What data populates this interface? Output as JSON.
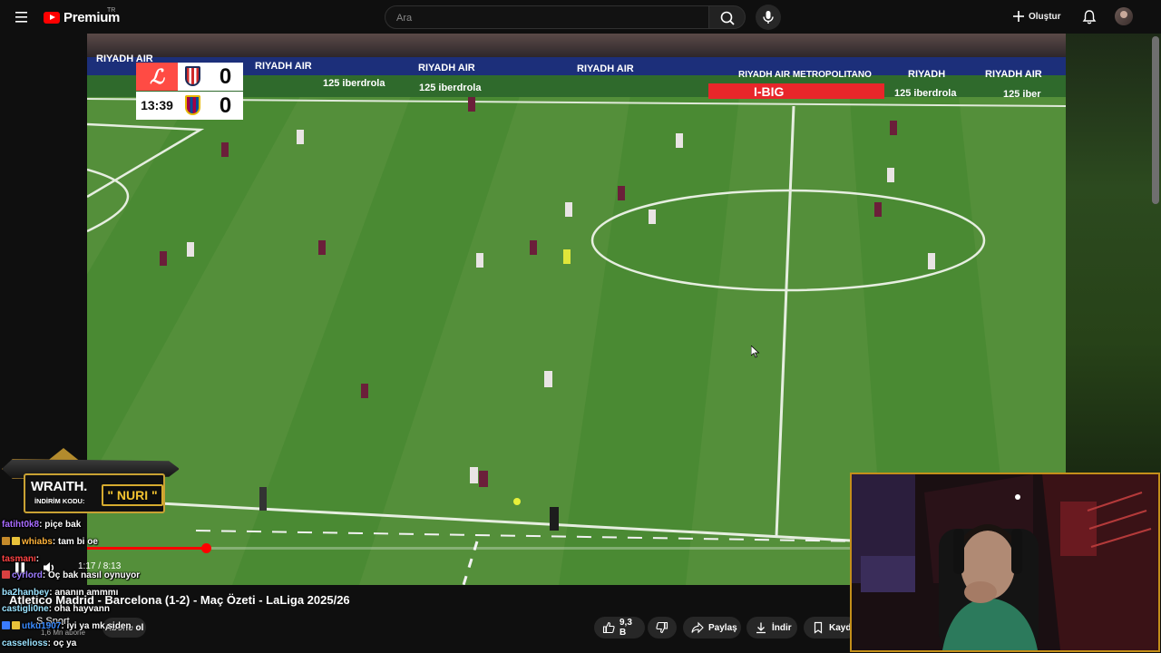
{
  "topbar": {
    "logo_text": "Premium",
    "country_code": "TR",
    "search_placeholder": "Ara",
    "create_label": "Oluştur"
  },
  "scoreboard": {
    "league_logo": "laliga-logo",
    "clock": "13:39",
    "home_score": "0",
    "away_score": "0",
    "home_crest": "atletico-crest",
    "away_crest": "barcelona-crest"
  },
  "ad_boards": {
    "sponsor_1": "RIYADH AIR",
    "sponsor_2": "RIYADH AIR METROPOLITANO",
    "sponsor_3": "125",
    "sponsor_4": "iberdrola",
    "sponsor_5": "I-BIG"
  },
  "player": {
    "time_current": "1:17",
    "time_total": "8:13",
    "time_display": "1:17 / 8:13",
    "progress_fraction": 0.156
  },
  "video": {
    "title": "Atletico Madrid - Barcelona (1-2) - Maç Özeti - LaLiga 2025/26",
    "channel": "S Sport",
    "subscribers": "1,6 Mn abone",
    "subscribe_label": "Abone ol"
  },
  "actions": {
    "like_count": "9,3 B",
    "share_label": "Paylaş",
    "download_label": "İndir",
    "save_label": "Kayde"
  },
  "sponsor": {
    "brand": "WRAITH.",
    "code_label": "İNDİRİM KODU:",
    "code": "\" NURI \""
  },
  "chat": [
    {
      "user": "fatiht0k8",
      "msg": ": piçe bak",
      "color": "#a86bff"
    },
    {
      "user": "whiabs",
      "msg": ": tam bi oe",
      "color": "#ffb33a"
    },
    {
      "user": "tasmanı",
      "msg": ":",
      "color": "#ff4444"
    },
    {
      "user": "cyrlord",
      "msg": ": Oç bak nasıl oynuyor",
      "color": "#9d7bff"
    },
    {
      "user": "ba2hanbey",
      "msg": ": ananın ammmı",
      "color": "#9be3ff"
    },
    {
      "user": "castigli0ne",
      "msg": ": oha hayvann",
      "color": "#9be3ff"
    },
    {
      "user": "utku1907",
      "msg": ": iyi ya mk siden",
      "color": "#3a8bff"
    },
    {
      "user": "casselioss",
      "msg": ": oç ya",
      "color": "#9be3ff"
    }
  ],
  "icons": {
    "menu": "hamburger-icon",
    "search": "search-icon",
    "mic": "mic-icon",
    "create": "plus-icon",
    "bell": "bell-icon",
    "play": "pause-icon",
    "volume": "volume-icon",
    "like": "thumbs-up-icon",
    "dislike": "thumbs-down-icon",
    "share": "share-icon",
    "download": "download-icon",
    "save": "bookmark-icon"
  },
  "colors": {
    "brand_red": "#ff0000",
    "pitch_green": "#4f8f37",
    "webcam_border": "#c48f1a"
  }
}
